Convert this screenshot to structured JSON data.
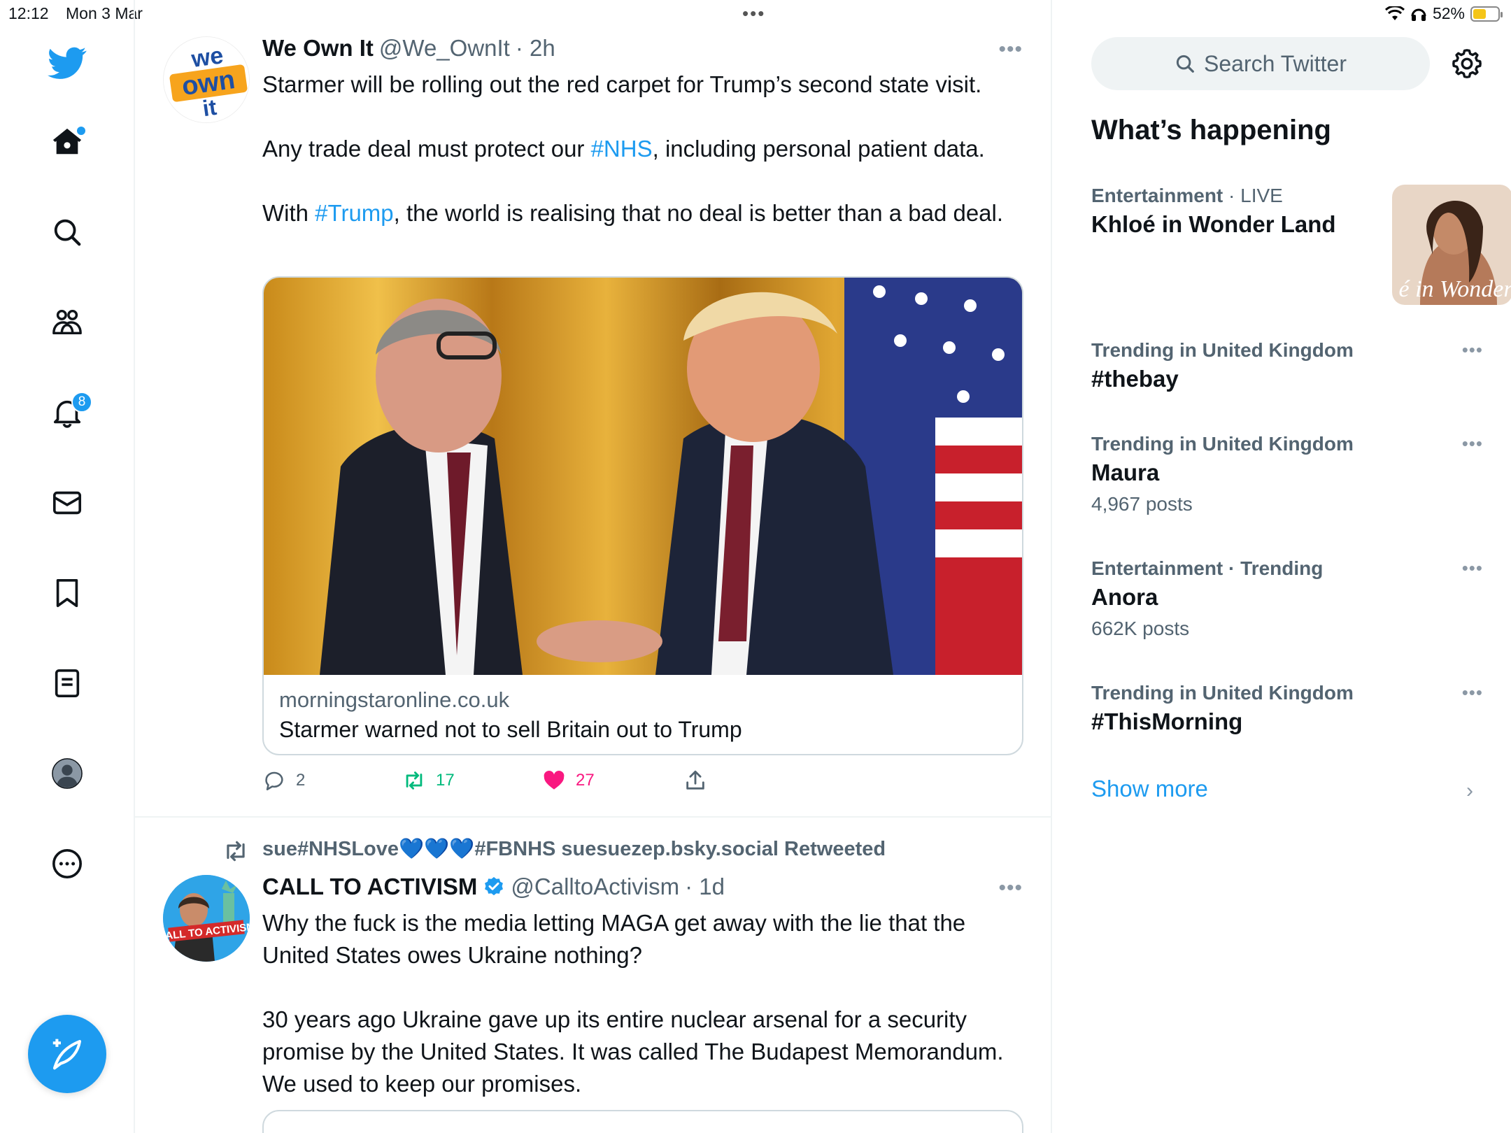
{
  "status_bar": {
    "time": "12:12",
    "date": "Mon 3 Mar",
    "battery_percent": "52%",
    "battery_level": 0.52
  },
  "nav": {
    "items": [
      {
        "name": "home",
        "icon": "home-icon"
      },
      {
        "name": "explore",
        "icon": "search-icon"
      },
      {
        "name": "communities",
        "icon": "people-icon"
      },
      {
        "name": "notifications",
        "icon": "bell-icon",
        "badge": "8"
      },
      {
        "name": "messages",
        "icon": "mail-icon"
      },
      {
        "name": "bookmarks",
        "icon": "bookmark-icon"
      },
      {
        "name": "lists",
        "icon": "list-icon"
      },
      {
        "name": "profile",
        "icon": "profile-icon"
      },
      {
        "name": "more",
        "icon": "more-icon"
      }
    ],
    "compose_icon": "compose-feather-icon"
  },
  "tweets": [
    {
      "name": "We Own It",
      "handle": "@We_OwnIt",
      "time": "· 2h",
      "paragraphs": [
        {
          "before": "Starmer will be rolling out the red carpet for Trump’s second state visit.",
          "tag": "",
          "after": ""
        },
        {
          "before": "Any trade deal must protect our ",
          "tag": "#NHS",
          "after": ", including personal patient data."
        },
        {
          "before": "With ",
          "tag": "#Trump",
          "after": ", the world is realising that no deal is better than a bad deal."
        }
      ],
      "card": {
        "domain": "morningstaronline.co.uk",
        "title": "Starmer warned not to sell Britain out to Trump"
      },
      "actions": {
        "replies": "2",
        "retweets": "17",
        "likes": "27"
      }
    },
    {
      "retweeted_by": "sue#NHSLove💙💙💙#FBNHS suesuezep.bsky.social Retweeted",
      "name": "CALL TO ACTIVISM",
      "handle": "@CalltoActivism",
      "time": "· 1d",
      "verified": true,
      "paragraphs": [
        {
          "before": "Why the fuck is the media letting MAGA get away with the lie that the United States owes Ukraine nothing?",
          "tag": "",
          "after": ""
        },
        {
          "before": "30 years ago Ukraine gave up its entire nuclear arsenal for a security promise by the United States. It was called The Budapest Memorandum. We used to keep our promises.",
          "tag": "",
          "after": ""
        }
      ]
    }
  ],
  "sidebar": {
    "search_placeholder": "Search Twitter",
    "title": "What’s happening",
    "trends": [
      {
        "category": "Entertainment",
        "meta": "· LIVE",
        "name": "Khloé in Wonder Land",
        "posts": "",
        "thumb_text": "é in Wonder l"
      },
      {
        "category": "Trending in United Kingdom",
        "meta": "",
        "name": "#thebay",
        "posts": ""
      },
      {
        "category": "Trending in United Kingdom",
        "meta": "",
        "name": "Maura",
        "posts": "4,967 posts"
      },
      {
        "category": "Entertainment · Trending",
        "meta": "",
        "name": "Anora",
        "posts": "662K posts"
      },
      {
        "category": "Trending in United Kingdom",
        "meta": "",
        "name": "#ThisMorning",
        "posts": ""
      }
    ],
    "show_more": "Show more"
  },
  "colors": {
    "accent": "#1d9bf0",
    "like": "#f91880",
    "retweet": "#00ba7c",
    "secondary_text": "#536471"
  }
}
